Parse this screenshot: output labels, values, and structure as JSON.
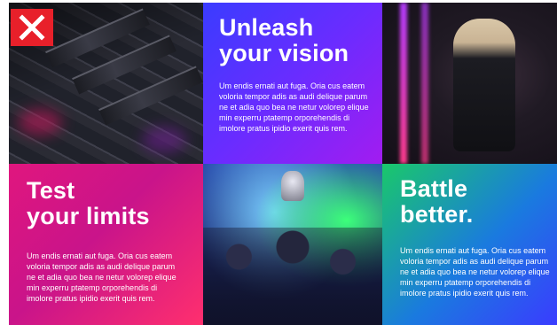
{
  "close_button": {
    "icon": "close-icon",
    "color": "#e8202a"
  },
  "tiles": {
    "vision": {
      "heading_line1": "Unleash",
      "heading_line2": "your vision",
      "body": "Um endis ernati aut fuga. Oria cus eatem voloria tempor adis as audi delique parum ne et adia quo bea ne netur volorep elique min experru ptatemp orporehendis di imolore pratus ipidio exerit quis rem."
    },
    "limits": {
      "heading_line1": "Test",
      "heading_line2": "your limits",
      "body": "Um endis ernati aut fuga. Oria cus eatem voloria tempor adis as audi delique parum ne et adia quo bea ne netur volorep elique min experru ptatemp orporehendis di imolore pratus ipidio exerit quis rem."
    },
    "battle": {
      "heading_line1": "Battle",
      "heading_line2": "better.",
      "body": "Um endis ernati aut fuga. Oria cus eatem voloria tempor adis as audi delique parum ne et adia quo bea ne netur volorep elique min experru ptatemp orporehendis di imolore pratus ipidio exerit quis rem."
    }
  },
  "colors": {
    "vision_gradient": [
      "#3a3cff",
      "#a21cf0"
    ],
    "limits_gradient": [
      "#e0167e",
      "#ff2f6e"
    ],
    "battle_gradient": [
      "#1ac86a",
      "#3a3cff"
    ]
  }
}
